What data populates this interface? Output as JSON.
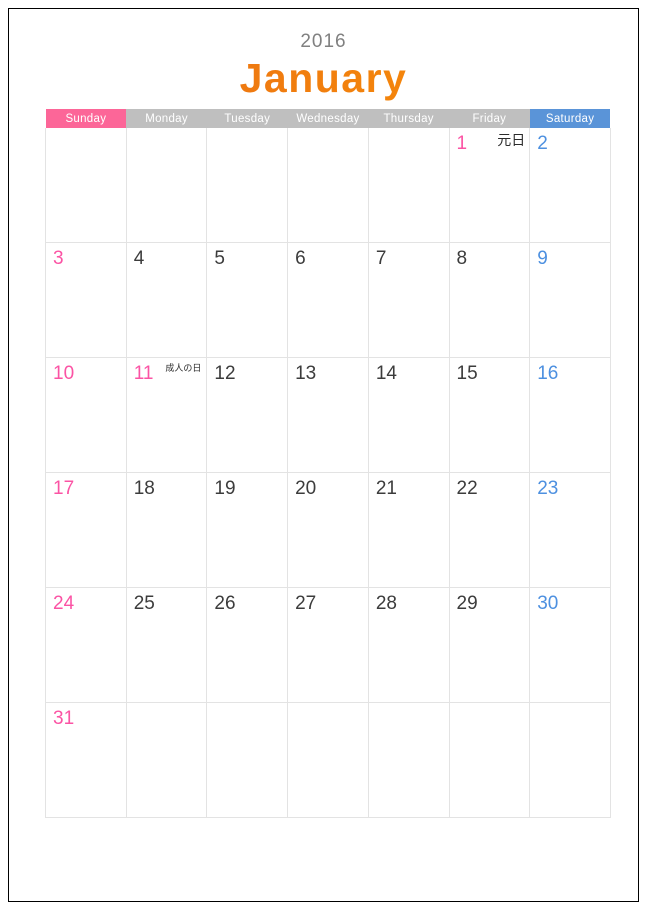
{
  "title": {
    "year": "2016",
    "month": "January"
  },
  "colors": {
    "sunday_header_bg": "#FC6698",
    "weekday_header_bg": "#BFBFBF",
    "saturday_header_bg": "#5A94D8",
    "sunday_text": "#FB53A4",
    "saturday_text": "#4D90E0",
    "weekday_text": "#3C3C3C",
    "month_accent": "#EF7A10",
    "year_text": "#808080",
    "grid_line": "#E3E3E3",
    "page_border": "#000000"
  },
  "weekdays": [
    {
      "label": "Sunday",
      "kind": "sun"
    },
    {
      "label": "Monday",
      "kind": "wd"
    },
    {
      "label": "Tuesday",
      "kind": "wd"
    },
    {
      "label": "Wednesday",
      "kind": "wd"
    },
    {
      "label": "Thursday",
      "kind": "wd"
    },
    {
      "label": "Friday",
      "kind": "wd"
    },
    {
      "label": "Saturday",
      "kind": "sat"
    }
  ],
  "weeks": [
    [
      {
        "day": "",
        "kind": "sun",
        "holiday": ""
      },
      {
        "day": "",
        "kind": "wd",
        "holiday": ""
      },
      {
        "day": "",
        "kind": "wd",
        "holiday": ""
      },
      {
        "day": "",
        "kind": "wd",
        "holiday": ""
      },
      {
        "day": "",
        "kind": "wd",
        "holiday": ""
      },
      {
        "day": "1",
        "kind": "hol",
        "holiday": "元日"
      },
      {
        "day": "2",
        "kind": "sat",
        "holiday": ""
      }
    ],
    [
      {
        "day": "3",
        "kind": "sun",
        "holiday": ""
      },
      {
        "day": "4",
        "kind": "wd",
        "holiday": ""
      },
      {
        "day": "5",
        "kind": "wd",
        "holiday": ""
      },
      {
        "day": "6",
        "kind": "wd",
        "holiday": ""
      },
      {
        "day": "7",
        "kind": "wd",
        "holiday": ""
      },
      {
        "day": "8",
        "kind": "wd",
        "holiday": ""
      },
      {
        "day": "9",
        "kind": "sat",
        "holiday": ""
      }
    ],
    [
      {
        "day": "10",
        "kind": "sun",
        "holiday": ""
      },
      {
        "day": "11",
        "kind": "hol",
        "holiday": "成人の日"
      },
      {
        "day": "12",
        "kind": "wd",
        "holiday": ""
      },
      {
        "day": "13",
        "kind": "wd",
        "holiday": ""
      },
      {
        "day": "14",
        "kind": "wd",
        "holiday": ""
      },
      {
        "day": "15",
        "kind": "wd",
        "holiday": ""
      },
      {
        "day": "16",
        "kind": "sat",
        "holiday": ""
      }
    ],
    [
      {
        "day": "17",
        "kind": "sun",
        "holiday": ""
      },
      {
        "day": "18",
        "kind": "wd",
        "holiday": ""
      },
      {
        "day": "19",
        "kind": "wd",
        "holiday": ""
      },
      {
        "day": "20",
        "kind": "wd",
        "holiday": ""
      },
      {
        "day": "21",
        "kind": "wd",
        "holiday": ""
      },
      {
        "day": "22",
        "kind": "wd",
        "holiday": ""
      },
      {
        "day": "23",
        "kind": "sat",
        "holiday": ""
      }
    ],
    [
      {
        "day": "24",
        "kind": "sun",
        "holiday": ""
      },
      {
        "day": "25",
        "kind": "wd",
        "holiday": ""
      },
      {
        "day": "26",
        "kind": "wd",
        "holiday": ""
      },
      {
        "day": "27",
        "kind": "wd",
        "holiday": ""
      },
      {
        "day": "28",
        "kind": "wd",
        "holiday": ""
      },
      {
        "day": "29",
        "kind": "wd",
        "holiday": ""
      },
      {
        "day": "30",
        "kind": "sat",
        "holiday": ""
      }
    ],
    [
      {
        "day": "31",
        "kind": "sun",
        "holiday": ""
      },
      {
        "day": "",
        "kind": "wd",
        "holiday": ""
      },
      {
        "day": "",
        "kind": "wd",
        "holiday": ""
      },
      {
        "day": "",
        "kind": "wd",
        "holiday": ""
      },
      {
        "day": "",
        "kind": "wd",
        "holiday": ""
      },
      {
        "day": "",
        "kind": "wd",
        "holiday": ""
      },
      {
        "day": "",
        "kind": "sat",
        "holiday": ""
      }
    ]
  ]
}
